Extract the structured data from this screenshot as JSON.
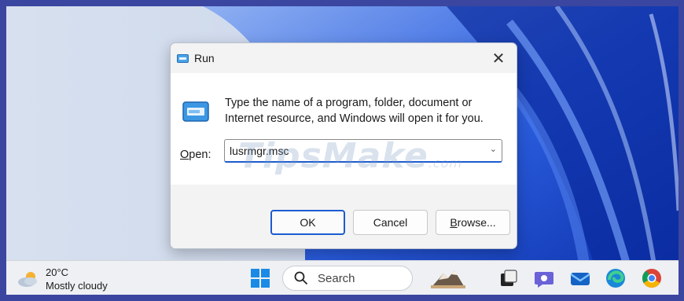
{
  "dialog": {
    "title": "Run",
    "description": "Type the name of a program, folder, document or Internet resource, and Windows will open it for you.",
    "open_label": "pen:",
    "open_label_mnemonic": "O",
    "open_value": "lusrmgr.msc",
    "ok_label": "OK",
    "cancel_label": "Cancel",
    "browse_label": "rowse...",
    "browse_label_mnemonic": "B",
    "close_glyph": "✕",
    "chevron_glyph": "⌄"
  },
  "watermark": {
    "brand": "TipsMake",
    "suffix": ".com"
  },
  "taskbar": {
    "weather_temp": "20°C",
    "weather_condition": "Mostly cloudy",
    "search_placeholder": "Search",
    "icons": [
      "start-icon",
      "search-icon",
      "widgets-icon",
      "task-view-icon",
      "teams-chat-icon",
      "mail-icon",
      "edge-icon",
      "chrome-icon"
    ]
  },
  "colors": {
    "accent": "#1c5bd0",
    "wallpaper_blue": "#1e4fd8",
    "taskbar": "#eef0f4"
  }
}
